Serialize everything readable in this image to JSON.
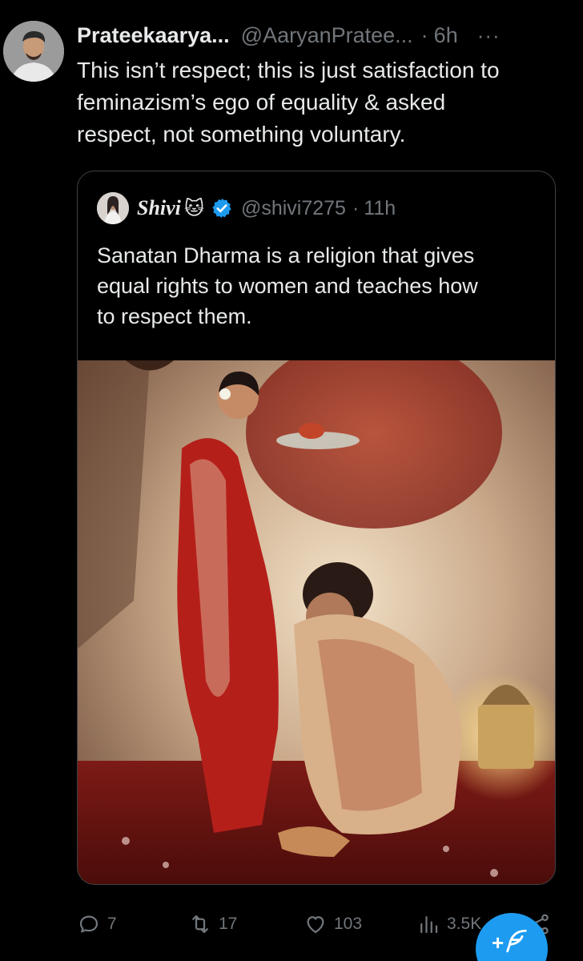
{
  "post": {
    "author_name": "Prateekaarya...",
    "author_handle": "@AaryanPratee...",
    "separator": "·",
    "time": "6h",
    "more_label": "···",
    "text": "This isn’t respect; this is just satisfaction to\nfeminazism’s ego of equality & asked\nrespect, not something voluntary."
  },
  "quoted_post": {
    "author_name": "Shivi",
    "author_emoji": "🐱",
    "verified": true,
    "author_handle": "@shivi7275",
    "separator": "·",
    "time": "11h",
    "text": "Sanatan Dharma is a religion that gives\nequal rights to women and teaches how\nto respect them."
  },
  "actions": {
    "replies": "7",
    "retweets": "17",
    "likes": "103",
    "views": "3.5K"
  },
  "fab": {
    "plus_label": "+",
    "icon": "feather-compose-icon"
  },
  "colors": {
    "background": "#000000",
    "text_primary": "#e7e9ea",
    "text_secondary": "#71767b",
    "border": "#3e4144",
    "accent": "#1d9bf0"
  },
  "icons": {
    "reply": "reply-icon",
    "retweet": "retweet-icon",
    "like": "heart-icon",
    "views": "views-icon",
    "share": "share-icon",
    "verified": "verified-badge-icon",
    "more": "more-icon"
  }
}
